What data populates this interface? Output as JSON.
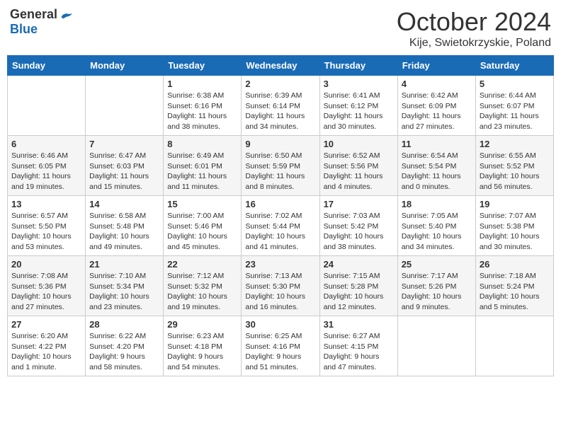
{
  "header": {
    "logo_general": "General",
    "logo_blue": "Blue",
    "month_title": "October 2024",
    "location": "Kije, Swietokrzyskie, Poland"
  },
  "days_of_week": [
    "Sunday",
    "Monday",
    "Tuesday",
    "Wednesday",
    "Thursday",
    "Friday",
    "Saturday"
  ],
  "weeks": [
    [
      {
        "day": "",
        "info": ""
      },
      {
        "day": "",
        "info": ""
      },
      {
        "day": "1",
        "info": "Sunrise: 6:38 AM\nSunset: 6:16 PM\nDaylight: 11 hours\nand 38 minutes."
      },
      {
        "day": "2",
        "info": "Sunrise: 6:39 AM\nSunset: 6:14 PM\nDaylight: 11 hours\nand 34 minutes."
      },
      {
        "day": "3",
        "info": "Sunrise: 6:41 AM\nSunset: 6:12 PM\nDaylight: 11 hours\nand 30 minutes."
      },
      {
        "day": "4",
        "info": "Sunrise: 6:42 AM\nSunset: 6:09 PM\nDaylight: 11 hours\nand 27 minutes."
      },
      {
        "day": "5",
        "info": "Sunrise: 6:44 AM\nSunset: 6:07 PM\nDaylight: 11 hours\nand 23 minutes."
      }
    ],
    [
      {
        "day": "6",
        "info": "Sunrise: 6:46 AM\nSunset: 6:05 PM\nDaylight: 11 hours\nand 19 minutes."
      },
      {
        "day": "7",
        "info": "Sunrise: 6:47 AM\nSunset: 6:03 PM\nDaylight: 11 hours\nand 15 minutes."
      },
      {
        "day": "8",
        "info": "Sunrise: 6:49 AM\nSunset: 6:01 PM\nDaylight: 11 hours\nand 11 minutes."
      },
      {
        "day": "9",
        "info": "Sunrise: 6:50 AM\nSunset: 5:59 PM\nDaylight: 11 hours\nand 8 minutes."
      },
      {
        "day": "10",
        "info": "Sunrise: 6:52 AM\nSunset: 5:56 PM\nDaylight: 11 hours\nand 4 minutes."
      },
      {
        "day": "11",
        "info": "Sunrise: 6:54 AM\nSunset: 5:54 PM\nDaylight: 11 hours\nand 0 minutes."
      },
      {
        "day": "12",
        "info": "Sunrise: 6:55 AM\nSunset: 5:52 PM\nDaylight: 10 hours\nand 56 minutes."
      }
    ],
    [
      {
        "day": "13",
        "info": "Sunrise: 6:57 AM\nSunset: 5:50 PM\nDaylight: 10 hours\nand 53 minutes."
      },
      {
        "day": "14",
        "info": "Sunrise: 6:58 AM\nSunset: 5:48 PM\nDaylight: 10 hours\nand 49 minutes."
      },
      {
        "day": "15",
        "info": "Sunrise: 7:00 AM\nSunset: 5:46 PM\nDaylight: 10 hours\nand 45 minutes."
      },
      {
        "day": "16",
        "info": "Sunrise: 7:02 AM\nSunset: 5:44 PM\nDaylight: 10 hours\nand 41 minutes."
      },
      {
        "day": "17",
        "info": "Sunrise: 7:03 AM\nSunset: 5:42 PM\nDaylight: 10 hours\nand 38 minutes."
      },
      {
        "day": "18",
        "info": "Sunrise: 7:05 AM\nSunset: 5:40 PM\nDaylight: 10 hours\nand 34 minutes."
      },
      {
        "day": "19",
        "info": "Sunrise: 7:07 AM\nSunset: 5:38 PM\nDaylight: 10 hours\nand 30 minutes."
      }
    ],
    [
      {
        "day": "20",
        "info": "Sunrise: 7:08 AM\nSunset: 5:36 PM\nDaylight: 10 hours\nand 27 minutes."
      },
      {
        "day": "21",
        "info": "Sunrise: 7:10 AM\nSunset: 5:34 PM\nDaylight: 10 hours\nand 23 minutes."
      },
      {
        "day": "22",
        "info": "Sunrise: 7:12 AM\nSunset: 5:32 PM\nDaylight: 10 hours\nand 19 minutes."
      },
      {
        "day": "23",
        "info": "Sunrise: 7:13 AM\nSunset: 5:30 PM\nDaylight: 10 hours\nand 16 minutes."
      },
      {
        "day": "24",
        "info": "Sunrise: 7:15 AM\nSunset: 5:28 PM\nDaylight: 10 hours\nand 12 minutes."
      },
      {
        "day": "25",
        "info": "Sunrise: 7:17 AM\nSunset: 5:26 PM\nDaylight: 10 hours\nand 9 minutes."
      },
      {
        "day": "26",
        "info": "Sunrise: 7:18 AM\nSunset: 5:24 PM\nDaylight: 10 hours\nand 5 minutes."
      }
    ],
    [
      {
        "day": "27",
        "info": "Sunrise: 6:20 AM\nSunset: 4:22 PM\nDaylight: 10 hours\nand 1 minute."
      },
      {
        "day": "28",
        "info": "Sunrise: 6:22 AM\nSunset: 4:20 PM\nDaylight: 9 hours\nand 58 minutes."
      },
      {
        "day": "29",
        "info": "Sunrise: 6:23 AM\nSunset: 4:18 PM\nDaylight: 9 hours\nand 54 minutes."
      },
      {
        "day": "30",
        "info": "Sunrise: 6:25 AM\nSunset: 4:16 PM\nDaylight: 9 hours\nand 51 minutes."
      },
      {
        "day": "31",
        "info": "Sunrise: 6:27 AM\nSunset: 4:15 PM\nDaylight: 9 hours\nand 47 minutes."
      },
      {
        "day": "",
        "info": ""
      },
      {
        "day": "",
        "info": ""
      }
    ]
  ]
}
